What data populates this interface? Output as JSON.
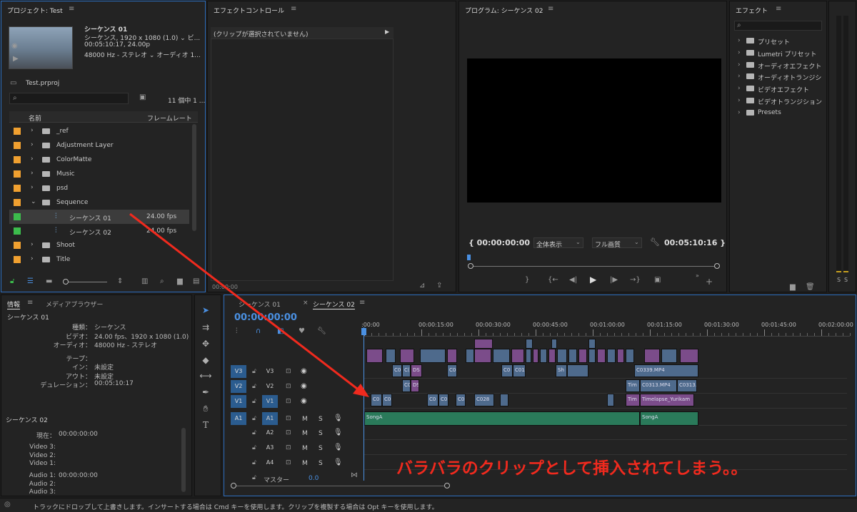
{
  "project": {
    "title": "プロジェクト: Test",
    "seq_name": "シーケンス 01",
    "seq_line1": "シーケンス, 1920 x 1080 (1.0) ⌄ ビ...",
    "seq_line2": "00:05:10:17, 24.00p",
    "seq_line3": "48000 Hz - ステレオ ⌄ オーディオ 1...",
    "file": "Test.prproj",
    "count": "11 個中 1 ...",
    "col_name": "名前",
    "col_fps": "フレームレート",
    "items": [
      {
        "name": "_ref",
        "color": "#f0a030",
        "type": "folder",
        "fps": ""
      },
      {
        "name": "Adjustment Layer",
        "color": "#f0a030",
        "type": "folder",
        "fps": ""
      },
      {
        "name": "ColorMatte",
        "color": "#f0a030",
        "type": "folder",
        "fps": ""
      },
      {
        "name": "Music",
        "color": "#f0a030",
        "type": "folder",
        "fps": ""
      },
      {
        "name": "psd",
        "color": "#f0a030",
        "type": "folder",
        "fps": ""
      },
      {
        "name": "Sequence",
        "color": "#f0a030",
        "type": "folder-open",
        "fps": ""
      },
      {
        "name": "シーケンス 01",
        "color": "#3cbc4c",
        "type": "seq",
        "fps": "24.00 fps"
      },
      {
        "name": "シーケンス 02",
        "color": "#3cbc4c",
        "type": "seq",
        "fps": "24.00 fps"
      },
      {
        "name": "Shoot",
        "color": "#f0a030",
        "type": "folder",
        "fps": ""
      },
      {
        "name": "Title",
        "color": "#f0a030",
        "type": "folder",
        "fps": ""
      }
    ]
  },
  "effect_controls": {
    "title": "エフェクトコントロール",
    "no_clip": "(クリップが選択されていません)",
    "timecode": "00:00:00"
  },
  "program": {
    "title": "プログラム: シーケンス 02",
    "tc_left": "{ 00:00:00:00",
    "zoom": "全体表示",
    "quality": "フル画質",
    "tc_right": "00:05:10:16 }"
  },
  "effects": {
    "title": "エフェクト",
    "items": [
      "プリセット",
      "Lumetri プリセット",
      "オーディオエフェクト",
      "オーディオトランジシ",
      "ビデオエフェクト",
      "ビデオトランジション",
      "Presets"
    ]
  },
  "meter": {
    "labels": [
      "S",
      "S"
    ]
  },
  "info": {
    "tab1": "情報",
    "tab2": "メディアブラウザー",
    "seq1": "シーケンス 01",
    "rows": [
      {
        "k": "種類：",
        "v": "シーケンス"
      },
      {
        "k": "ビデオ：",
        "v": "24.00 fps、1920 x 1080 (1.0)"
      },
      {
        "k": "オーディオ：",
        "v": "48000 Hz - ステレオ"
      },
      {
        "k": "テープ：",
        "v": ""
      },
      {
        "k": "イン：",
        "v": "未設定"
      },
      {
        "k": "アウト：",
        "v": "未設定"
      },
      {
        "k": "デュレーション：",
        "v": "00:05:10:17"
      }
    ],
    "seq2": "シーケンス 02",
    "rows2": [
      {
        "k": "現在：",
        "v": "00:00:00:00"
      },
      {
        "k": "Video 3:",
        "v": ""
      },
      {
        "k": "Video 2:",
        "v": ""
      },
      {
        "k": "Video 1:",
        "v": ""
      },
      {
        "k": "Audio 1:",
        "v": "00:00:00:00"
      },
      {
        "k": "Audio 2:",
        "v": ""
      },
      {
        "k": "Audio 3:",
        "v": ""
      }
    ]
  },
  "timeline": {
    "tab1": "シーケンス 01",
    "tab2": "シーケンス 02",
    "timecode": "00:00:00:00",
    "ruler": [
      ":00:00",
      "00:00:15:00",
      "00:00:30:00",
      "00:00:45:00",
      "00:01:00:00",
      "00:01:15:00",
      "00:01:30:00",
      "00:01:45:00",
      "00:02:00:00"
    ],
    "tracks": {
      "v3": "V3",
      "v2": "V2",
      "v1": "V1",
      "a1": "A1",
      "a2": "A2",
      "a3": "A3",
      "a4": "A4",
      "m": "M",
      "s": "S",
      "master": "マスター",
      "master_val": "0.0"
    },
    "clips": {
      "v3_a": "C0",
      "v3_b": "C(",
      "v3_c": "DS",
      "v3_d": "C0",
      "v3_e": "C0",
      "v3_f": "C01",
      "v3_g": "Sh",
      "v3_h": "C0339.MP4",
      "v2_a": "C0",
      "v2_b": "DS",
      "v2_c": "Tim",
      "v2_d": "C0313.MP4",
      "v2_e": "C0313.",
      "v1_a": "C0",
      "v1_b": "C0",
      "v1_c": "C0",
      "v1_d": "C0",
      "v1_e": "C0",
      "v1_f": "C028",
      "v1_g": "Tim",
      "v1_h": "Timelapse_Yurikam",
      "a1_a": "SongA",
      "a1_b": "SongA"
    },
    "annotation": "バラバラのクリップとして挿入されてしまう。。"
  },
  "status": {
    "text": "トラックにドロップして上書きします。インサートする場合は Cmd キーを使用します。クリップを複製する場合は Opt キーを使用します。"
  }
}
